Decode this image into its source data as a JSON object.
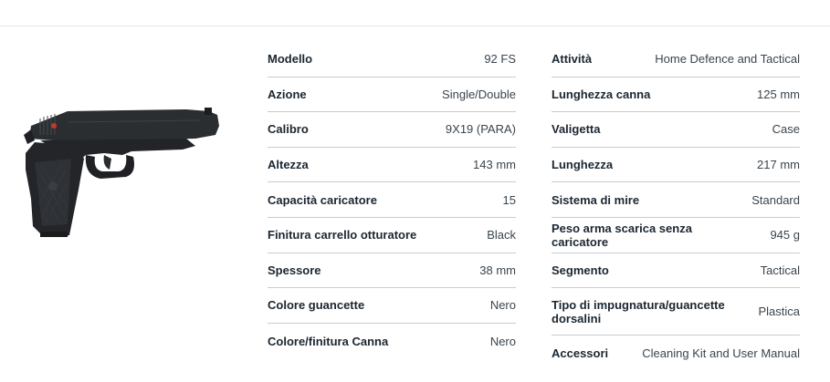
{
  "product": {
    "image_alt": "pistol-image"
  },
  "specs_left": [
    {
      "label": "Modello",
      "value": "92 FS"
    },
    {
      "label": "Azione",
      "value": "Single/Double"
    },
    {
      "label": "Calibro",
      "value": "9X19 (PARA)"
    },
    {
      "label": "Altezza",
      "value": "143 mm"
    },
    {
      "label": "Capacità caricatore",
      "value": "15"
    },
    {
      "label": "Finitura carrello otturatore",
      "value": "Black"
    },
    {
      "label": "Spessore",
      "value": "38 mm"
    },
    {
      "label": "Colore guancette",
      "value": "Nero"
    },
    {
      "label": "Colore/finitura Canna",
      "value": "Nero"
    }
  ],
  "specs_right": [
    {
      "label": "Attività",
      "value": "Home Defence and Tactical"
    },
    {
      "label": "Lunghezza canna",
      "value": "125 mm"
    },
    {
      "label": "Valigetta",
      "value": "Case"
    },
    {
      "label": "Lunghezza",
      "value": "217 mm"
    },
    {
      "label": "Sistema di mire",
      "value": "Standard"
    },
    {
      "label": "Peso arma scarica senza caricatore",
      "value": "945 g"
    },
    {
      "label": "Segmento",
      "value": "Tactical"
    },
    {
      "label": "Tipo di impugnatura/guancette dorsalini",
      "value": "Plastica"
    },
    {
      "label": "Accessori",
      "value": "Cleaning Kit and User Manual"
    }
  ]
}
